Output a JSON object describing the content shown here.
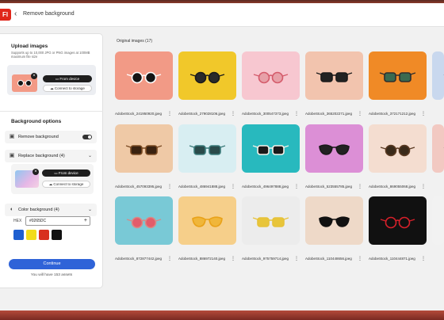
{
  "app": {
    "logo_text": "Fl",
    "back_icon": "chevron-left-icon",
    "title": "Remove background"
  },
  "upload": {
    "heading": "Upload images",
    "description": "Supports up to 10,000 JPG or PNG images at 100MB maximum file size",
    "from_device": "From device",
    "connect_storage": "Connect to storage"
  },
  "bg_options": {
    "heading": "Background options",
    "remove_bg": "Remove background",
    "replace_bg": "Replace background (4)",
    "from_device": "From device",
    "connect_storage": "Connect to storage",
    "color_bg": "Color background (4)",
    "hex_label": "HEX",
    "hex_value": "#0265DC",
    "swatches": [
      "#1e5fd0",
      "#f2dc1a",
      "#d8301f",
      "#111111"
    ]
  },
  "footer": {
    "continue": "Continue",
    "assets_note": "You will have 153 assets"
  },
  "gallery": {
    "title": "Original images (17)",
    "rows": [
      [
        {
          "name": "AdobeStock_241950920.jpeg",
          "bg": "#f29a86",
          "frame": "#ffffff",
          "lens": "#151515",
          "shape": "round"
        },
        {
          "name": "AdobeStock_279028106.jpeg",
          "bg": "#f1c82a",
          "frame": "#1a1a1a",
          "lens": "#2a2a2a",
          "shape": "round"
        },
        {
          "name": "AdobeStock_300547373.jpeg",
          "bg": "#f7c7d0",
          "frame": "#d45a6a",
          "lens": "#e7a0a8",
          "shape": "round"
        },
        {
          "name": "AdobeStock_365202271.jpeg",
          "bg": "#f2c4ae",
          "frame": "#1a1a1a",
          "lens": "#222222",
          "shape": "square"
        },
        {
          "name": "AdobeStock_372171212.jpeg",
          "bg": "#f08a26",
          "frame": "#2e2e2e",
          "lens": "#3a6a50",
          "shape": "square"
        },
        {
          "name": "",
          "bg": "#c9d8ee",
          "frame": "#333333",
          "lens": "#555555",
          "shape": "round"
        }
      ],
      [
        {
          "name": "AdobeStock_457093395.jpeg",
          "bg": "#efc9a6",
          "frame": "#7a4a22",
          "lens": "#3a2210",
          "shape": "square"
        },
        {
          "name": "AdobeStock_486941888.jpeg",
          "bg": "#d8eef2",
          "frame": "#3a7a7a",
          "lens": "#2a4a4a",
          "shape": "square"
        },
        {
          "name": "AdobeStock_496497888.jpeg",
          "bg": "#28b9be",
          "frame": "#f6f3ea",
          "lens": "#1a1a1a",
          "shape": "square"
        },
        {
          "name": "AdobeStock_523555785.jpeg",
          "bg": "#dc8fd6",
          "frame": "#1a1a1a",
          "lens": "#222222",
          "shape": "cat"
        },
        {
          "name": "AdobeStock_869055068.jpeg",
          "bg": "#f4ddd0",
          "frame": "#5a3a22",
          "lens": "#3a2a1a",
          "shape": "round"
        },
        {
          "name": "",
          "bg": "#f2c9c2",
          "frame": "#444444",
          "lens": "#555555",
          "shape": "round"
        }
      ],
      [
        {
          "name": "AdobeStock_872877442.jpeg",
          "bg": "#79c9d6",
          "frame": "#d88a86",
          "lens": "#e35c6a",
          "shape": "round"
        },
        {
          "name": "AdobeStock_886972140.jpeg",
          "bg": "#f6cf8a",
          "frame": "#e9a21a",
          "lens": "#f0b63a",
          "shape": "cat"
        },
        {
          "name": "AdobeStock_975759714.jpeg",
          "bg": "#ececec",
          "frame": "#e6c23a",
          "lens": "#e8c53a",
          "shape": "square"
        },
        {
          "name": "AdobeStock_110448656.jpeg",
          "bg": "#eed9c8",
          "frame": "#111111",
          "lens": "#111111",
          "shape": "cat"
        },
        {
          "name": "AdobeStock_110444871.jpeg",
          "bg": "#111111",
          "frame": "#d8202a",
          "lens": "#101010",
          "shape": "round"
        },
        {
          "name": "",
          "bg": "#f2f2f2",
          "frame": "#eeeeee",
          "lens": "#eeeeee",
          "shape": "none"
        }
      ]
    ]
  }
}
